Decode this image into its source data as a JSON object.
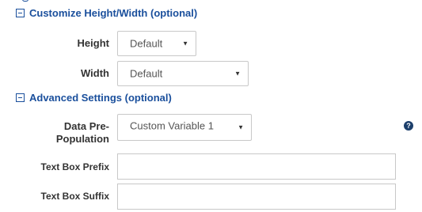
{
  "sections": {
    "customize": {
      "title": "Customize Height/Width (optional)",
      "height_label": "Height",
      "height_value": "Default",
      "width_label": "Width",
      "width_value": "Default"
    },
    "advanced": {
      "title": "Advanced Settings (optional)",
      "prepop_label_line1": "Data Pre-",
      "prepop_label_line2": "Population",
      "prepop_value": "Custom Variable 1",
      "prefix_label": "Text Box Prefix",
      "prefix_value": "",
      "suffix_label": "Text Box Suffix",
      "suffix_value": "",
      "help_icon_glyph": "?"
    }
  },
  "icons": {
    "collapse": "collapse-icon",
    "dropdown": "▼",
    "help": "help-icon"
  },
  "colors": {
    "section_header": "#1a4f9c",
    "label": "#333333",
    "help_icon": "#1c3f6b"
  }
}
